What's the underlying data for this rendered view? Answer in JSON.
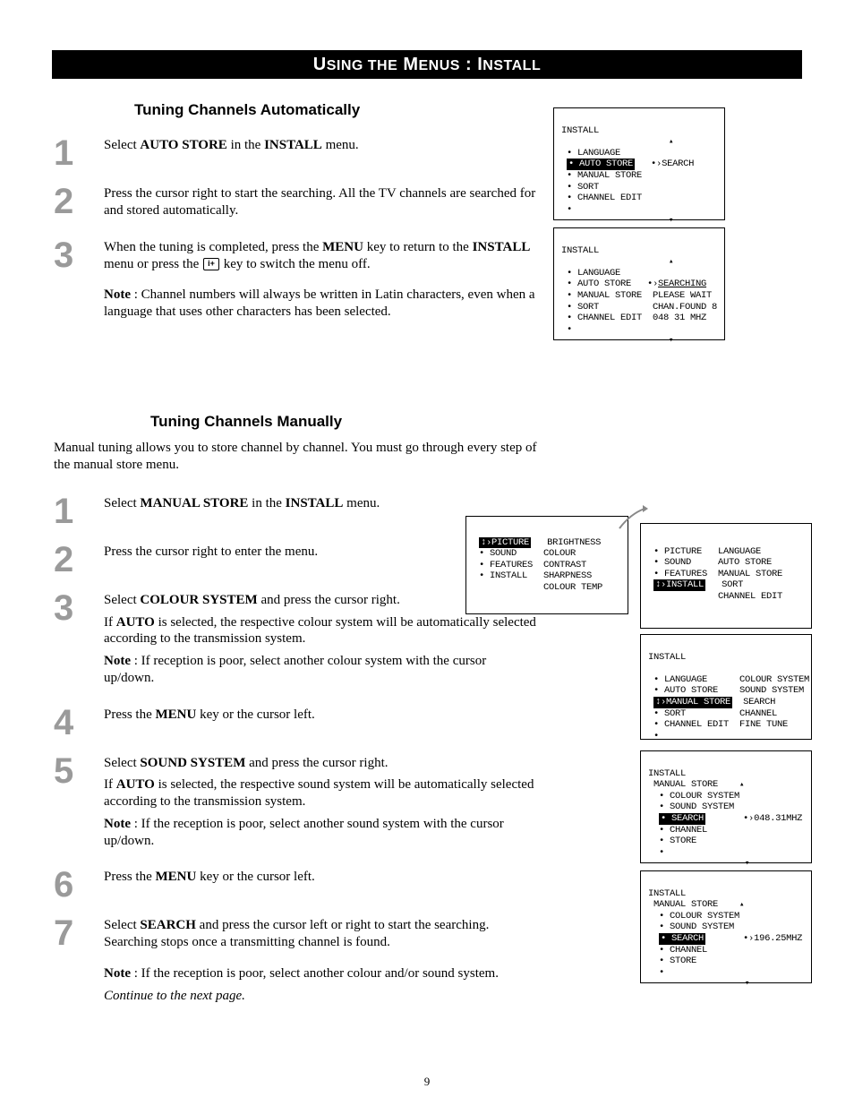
{
  "title_bar": "USING THE MENUS : INSTALL",
  "section1": {
    "heading": "Tuning Channels Automatically",
    "step1": {
      "num": "1",
      "text": [
        "Select ",
        "AUTO STORE",
        " in the ",
        "INSTALL",
        " menu."
      ]
    },
    "step2": {
      "num": "2",
      "text": "Press the cursor right to start the searching. All the TV channels are searched for and stored automatically."
    },
    "step3": {
      "num": "3",
      "p1a": "When the tuning is completed, press the ",
      "p1b": "MENU",
      "p1c": " key to return to the ",
      "p1d": "INSTALL",
      "p1e": " menu or press the ",
      "p1f": " key to switch the menu off.",
      "note": [
        "Note",
        " : Channel numbers will always be written in Latin characters, even when a language that uses other characters has been selected."
      ]
    }
  },
  "osd1": {
    "title": "INSTALL",
    "items": [
      "LANGUAGE",
      "AUTO STORE",
      "MANUAL STORE",
      "SORT",
      "CHANNEL EDIT"
    ],
    "selected": 1,
    "right": "SEARCH",
    "nav_top": "▴",
    "nav_bot": "▾"
  },
  "osd2": {
    "title": "INSTALL",
    "items": [
      "LANGUAGE",
      "AUTO STORE",
      "MANUAL STORE",
      "SORT",
      "CHANNEL EDIT"
    ],
    "right": [
      "SEARCHING",
      "PLEASE WAIT",
      "CHAN.FOUND 8",
      "048 31 MHZ"
    ],
    "nav_top": "▴",
    "nav_bot": "▾"
  },
  "section2": {
    "heading": "Tuning Channels Manually",
    "intro": "Manual tuning allows you to store channel by channel. You must go through every step of the manual store menu.",
    "step1": {
      "num": "1",
      "text": [
        "Select ",
        "MANUAL STORE",
        " in the ",
        "INSTALL",
        " menu."
      ]
    },
    "step2": {
      "num": "2",
      "text": "Press the cursor right to enter the menu."
    },
    "step3": {
      "num": "3",
      "p1": [
        "Select ",
        "COLOUR SYSTEM",
        " and press the cursor right."
      ],
      "p2": [
        "If ",
        "AUTO",
        " is selected, the respective colour system will be automatically selected according to the transmission system."
      ],
      "note": [
        "Note",
        " : If reception is poor, select another colour system with the cursor up/down."
      ]
    },
    "step4": {
      "num": "4",
      "text": [
        "Press the ",
        "MENU",
        " key or the cursor left."
      ]
    },
    "step5": {
      "num": "5",
      "p1": [
        "Select ",
        "SOUND SYSTEM",
        " and press the cursor right."
      ],
      "p2": [
        "If ",
        "AUTO",
        " is selected, the respective sound system will be automatically selected according to the transmission system."
      ],
      "note": [
        "Note",
        " : If the reception is poor, select another sound system with the cursor up/down."
      ]
    },
    "step6": {
      "num": "6",
      "text": [
        "Press the ",
        "MENU",
        " key or the cursor left."
      ]
    },
    "step7": {
      "num": "7",
      "p1": [
        "Select ",
        "SEARCH",
        " and press the cursor left or right to start the searching. Searching stops once a transmitting channel is found."
      ],
      "note": [
        "Note",
        " : If the reception is poor, select another colour and/or sound system."
      ],
      "cont": "Continue to the next page."
    }
  },
  "osd3": {
    "left_items": [
      "PICTURE",
      "SOUND",
      "FEATURES",
      "INSTALL"
    ],
    "left_selected": 0,
    "right_items": [
      "BRIGHTNESS",
      "COLOUR",
      "CONTRAST",
      "SHARPNESS",
      "COLOUR TEMP"
    ]
  },
  "osd4": {
    "left_items": [
      "PICTURE",
      "SOUND",
      "FEATURES",
      "INSTALL"
    ],
    "left_selected": 3,
    "right_items": [
      "LANGUAGE",
      "AUTO STORE",
      "MANUAL STORE",
      "SORT",
      "CHANNEL EDIT"
    ]
  },
  "osd5": {
    "title": "INSTALL",
    "left_items": [
      "LANGUAGE",
      "AUTO STORE",
      "MANUAL STORE",
      "SORT",
      "CHANNEL EDIT"
    ],
    "left_selected": 2,
    "right_items": [
      "COLOUR SYSTEM",
      "SOUND SYSTEM",
      "SEARCH",
      "CHANNEL",
      "FINE TUNE"
    ]
  },
  "osd6": {
    "title": "INSTALL",
    "sub": "MANUAL STORE",
    "items": [
      "COLOUR SYSTEM",
      "SOUND SYSTEM",
      "SEARCH",
      "CHANNEL",
      "STORE"
    ],
    "selected": 2,
    "value": "048.31MHZ",
    "nav_top": "▴",
    "nav_bot": "▾"
  },
  "osd7": {
    "title": "INSTALL",
    "sub": "MANUAL STORE",
    "items": [
      "COLOUR SYSTEM",
      "SOUND SYSTEM",
      "SEARCH",
      "CHANNEL",
      "STORE"
    ],
    "selected": 2,
    "value": "196.25MHZ",
    "nav_top": "▴",
    "nav_bot": "▾"
  },
  "page_number": "9"
}
